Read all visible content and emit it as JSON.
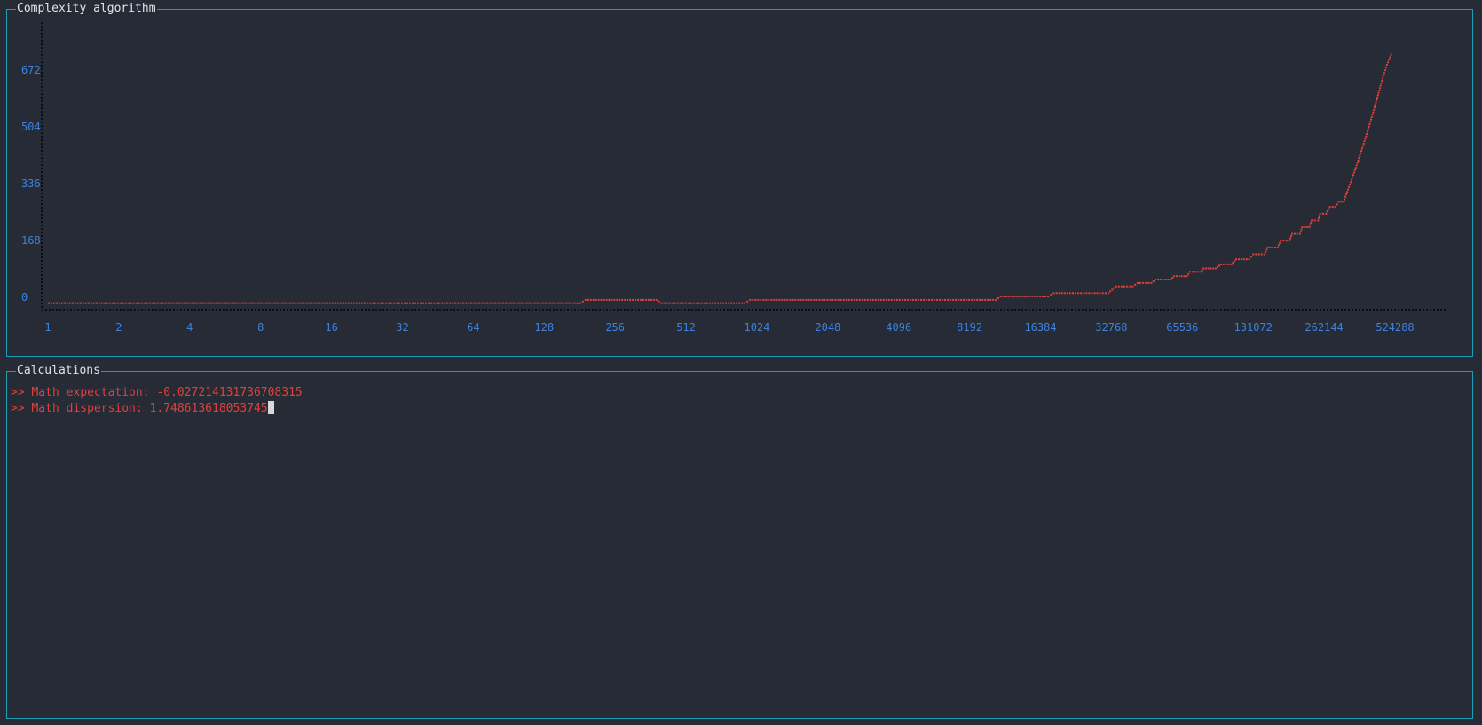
{
  "chart_panel": {
    "title": "Complexity algorithm"
  },
  "calc_panel": {
    "title": "Calculations",
    "lines": [
      {
        "prompt": ">>",
        "label": "Math expectation:",
        "value": "-0.027214131736708315"
      },
      {
        "prompt": ">>",
        "label": "Math dispersion:",
        "value": "1.748613618053745"
      }
    ]
  },
  "colors": {
    "background": "#262b35",
    "border": "#1c9fb4",
    "tick_label": "#3c82e0",
    "series": "#e0403c",
    "axis": "#0a0d12"
  },
  "chart_data": {
    "type": "scatter",
    "title": "Complexity algorithm",
    "xlabel": "",
    "ylabel": "",
    "x_scale": "log2",
    "x_ticks": [
      "1",
      "2",
      "4",
      "8",
      "16",
      "32",
      "64",
      "128",
      "256",
      "512",
      "1024",
      "2048",
      "4096",
      "8192",
      "16384",
      "32768",
      "65536",
      "131072",
      "262144",
      "524288"
    ],
    "y_ticks": [
      "0",
      "168",
      "336",
      "504",
      "672"
    ],
    "xlim": [
      1,
      1048576
    ],
    "ylim": [
      -40,
      780
    ],
    "grid": false,
    "legend": "none",
    "series": [
      {
        "marker": "dot-steps",
        "points": [
          [
            1,
            -15
          ],
          [
            180,
            -15
          ],
          [
            190,
            -5
          ],
          [
            380,
            -5
          ],
          [
            400,
            -15
          ],
          [
            900,
            -15
          ],
          [
            950,
            -5
          ],
          [
            10500,
            -5
          ],
          [
            11000,
            5
          ],
          [
            17500,
            5
          ],
          [
            18500,
            15
          ],
          [
            31500,
            15
          ],
          [
            34000,
            35
          ],
          [
            40000,
            35
          ],
          [
            42000,
            45
          ],
          [
            48000,
            45
          ],
          [
            50000,
            55
          ],
          [
            58000,
            55
          ],
          [
            60000,
            65
          ],
          [
            68000,
            65
          ],
          [
            70000,
            78
          ],
          [
            78000,
            78
          ],
          [
            80000,
            88
          ],
          [
            90000,
            88
          ],
          [
            95000,
            100
          ],
          [
            105000,
            100
          ],
          [
            110000,
            115
          ],
          [
            125000,
            115
          ],
          [
            130000,
            130
          ],
          [
            145000,
            130
          ],
          [
            150000,
            150
          ],
          [
            165000,
            150
          ],
          [
            170000,
            170
          ],
          [
            185000,
            170
          ],
          [
            190000,
            190
          ],
          [
            205000,
            190
          ],
          [
            210000,
            210
          ],
          [
            225000,
            210
          ],
          [
            230000,
            230
          ],
          [
            245000,
            230
          ],
          [
            250000,
            250
          ],
          [
            265000,
            250
          ],
          [
            275000,
            270
          ],
          [
            290000,
            270
          ],
          [
            300000,
            285
          ],
          [
            315000,
            285
          ],
          [
            320000,
            300
          ],
          [
            340000,
            350
          ],
          [
            360000,
            400
          ],
          [
            380000,
            450
          ],
          [
            400000,
            500
          ],
          [
            420000,
            550
          ],
          [
            440000,
            600
          ],
          [
            460000,
            650
          ],
          [
            480000,
            690
          ],
          [
            500000,
            720
          ]
        ]
      }
    ]
  }
}
